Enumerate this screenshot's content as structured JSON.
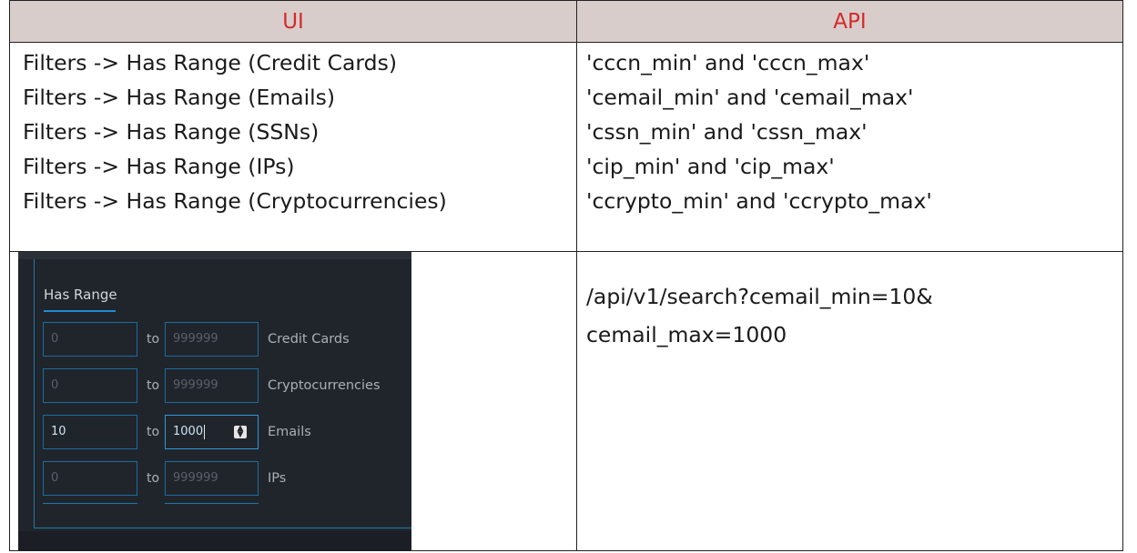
{
  "table": {
    "header": {
      "ui": "UI",
      "api": "API"
    },
    "mappings": [
      {
        "ui": "Filters -> Has Range (Credit Cards)",
        "api": "'cccn_min' and 'cccn_max'"
      },
      {
        "ui": "Filters -> Has Range (Emails)",
        "api": "'cemail_min' and 'cemail_max'"
      },
      {
        "ui": "Filters -> Has Range (SSNs)",
        "api": "'cssn_min' and 'cssn_max'"
      },
      {
        "ui": "Filters -> Has Range (IPs)",
        "api": "'cip_min' and 'cip_max'"
      },
      {
        "ui": "Filters -> Has Range (Cryptocurrencies)",
        "api": "'ccrypto_min' and 'ccrypto_max'"
      }
    ]
  },
  "screenshot": {
    "title": "Has Range",
    "to_label": "to",
    "rows": [
      {
        "min": "0",
        "max": "999999",
        "label": "Credit Cards"
      },
      {
        "min": "0",
        "max": "999999",
        "label": "Cryptocurrencies"
      },
      {
        "min": "10",
        "max": "1000",
        "label": "Emails"
      },
      {
        "min": "0",
        "max": "999999",
        "label": "IPs"
      }
    ]
  },
  "example": {
    "url_line1": "/api/v1/search?cemail_min=10&",
    "url_line2": "cemail_max=1000"
  },
  "colors": {
    "header_bg": "#d9cdcb",
    "header_text": "#d22b2b",
    "panel_bg": "#20252c",
    "accent": "#1f8bd0"
  }
}
